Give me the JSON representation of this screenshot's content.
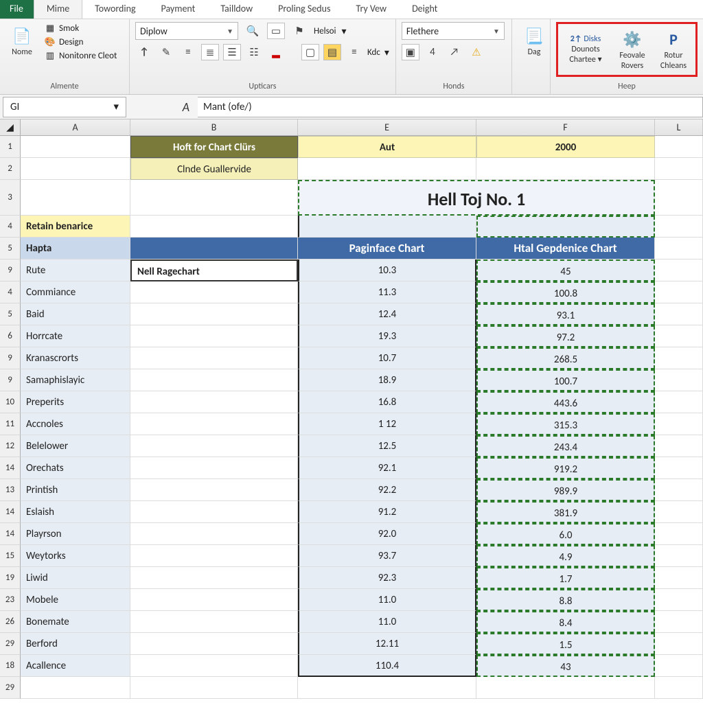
{
  "tabs": {
    "file": "File",
    "items": [
      "Mime",
      "Towording",
      "Payment",
      "Tailldow",
      "Proling Sedus",
      "Try Vew",
      "Deight"
    ],
    "active_index": 0
  },
  "ribbon": {
    "group1": {
      "big": "Nome",
      "list": [
        "Smok",
        "Design",
        "Nonitonre Cleot"
      ],
      "label": "Almente"
    },
    "group2": {
      "combo": "Diplow",
      "helso": "Helsoi",
      "kdc": "Kdc",
      "label": "Upticars"
    },
    "group3": {
      "combo": "Flethere",
      "label": "Honds"
    },
    "group4": {
      "dag": "Dag"
    },
    "group5": {
      "disks": "Disks",
      "dounots": "Dounots",
      "chartee": "Chartee",
      "feovale": "Feovale",
      "rovers": "Rovers",
      "rotur": "Rotur",
      "chleans": "Chleans",
      "label": "Heep"
    }
  },
  "name_box": "GI",
  "fx_label": "A",
  "formula": "Mant (ofe/)",
  "columns": [
    "A",
    "B",
    "E",
    "F",
    "L"
  ],
  "row_labels": [
    "1",
    "2",
    "3",
    "4",
    "5",
    "9",
    "4",
    "5",
    "6",
    "9",
    "9",
    "10",
    "11",
    "12",
    "14",
    "13",
    "14",
    "14",
    "15",
    "19",
    "23",
    "26",
    "29",
    "18",
    "29"
  ],
  "cells": {
    "b1": "Hoft for Chart Clürs",
    "e1": "Aut",
    "f1": "2000",
    "b2": "Clnde Guallervide",
    "title": "Hell Toj No. 1",
    "a4": "Retain benarice",
    "a5": "Hapta",
    "e5": "Paginface Chart",
    "f5": "Htal Gepdenice Chart",
    "b9": "Nell Ragechart"
  },
  "data_rows": [
    {
      "a": "Rute",
      "e": "10.3",
      "f": "45"
    },
    {
      "a": "Commiance",
      "e": "11.3",
      "f": "100.8"
    },
    {
      "a": "Baid",
      "e": "12.4",
      "f": "93.1"
    },
    {
      "a": "Horrcate",
      "e": "19.3",
      "f": "97.2"
    },
    {
      "a": "Kranascrorts",
      "e": "10.7",
      "f": "268.5"
    },
    {
      "a": "Samaphislayic",
      "e": "18.9",
      "f": "100.7"
    },
    {
      "a": "Preperits",
      "e": "16.8",
      "f": "443.6"
    },
    {
      "a": "Accnoles",
      "e": "1 12",
      "f": "315.3"
    },
    {
      "a": "Belelower",
      "e": "12.5",
      "f": "243.4"
    },
    {
      "a": "Orechats",
      "e": "92.1",
      "f": "919.2"
    },
    {
      "a": "Printish",
      "e": "92.2",
      "f": "989.9"
    },
    {
      "a": "Eslaish",
      "e": "91.2",
      "f": "381.9"
    },
    {
      "a": "Playrson",
      "e": "92.0",
      "f": "6.0"
    },
    {
      "a": "Weytorks",
      "e": "93.7",
      "f": "4.9"
    },
    {
      "a": "Liwid",
      "e": "92.3",
      "f": "1.7"
    },
    {
      "a": "Mobele",
      "e": "11.0",
      "f": "8.8"
    },
    {
      "a": "Bonemate",
      "e": "11.0",
      "f": "8.4"
    },
    {
      "a": "Berford",
      "e": "12.11",
      "f": "1.5"
    },
    {
      "a": "Acallence",
      "e": "110.4",
      "f": "43"
    }
  ]
}
